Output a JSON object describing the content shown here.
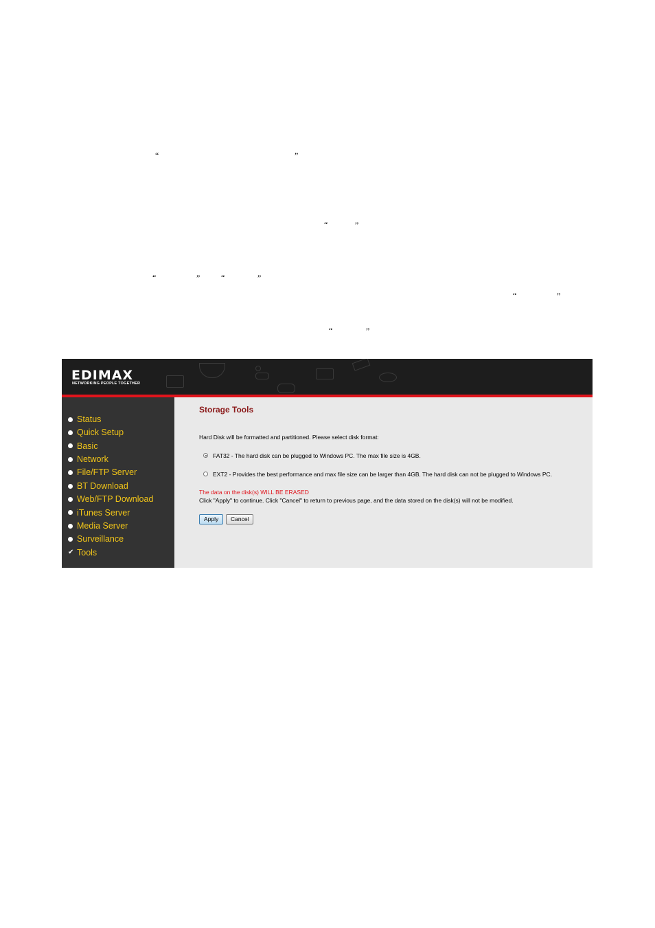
{
  "doc_quotes": {
    "q1": "“",
    "q2": "”",
    "q3": "“",
    "q4": "”",
    "q5": "“",
    "q6": "”",
    "q7": "“",
    "q8": "”",
    "q9": "“",
    "q10": "”",
    "q11": "“",
    "q12": "”"
  },
  "brand": {
    "logo": "EDIMAX",
    "tagline": "NETWORKING PEOPLE TOGETHER",
    "accent": "#e0141c"
  },
  "sidebar": {
    "items": [
      {
        "label": "Status",
        "icon": "bullet-icon"
      },
      {
        "label": "Quick Setup",
        "icon": "bullet-icon"
      },
      {
        "label": "Basic",
        "icon": "bullet-icon"
      },
      {
        "label": "Network",
        "icon": "bullet-icon"
      },
      {
        "label": "File/FTP Server",
        "icon": "bullet-icon"
      },
      {
        "label": "BT Download",
        "icon": "bullet-icon"
      },
      {
        "label": "Web/FTP Download",
        "icon": "bullet-icon"
      },
      {
        "label": "iTunes Server",
        "icon": "bullet-icon"
      },
      {
        "label": "Media Server",
        "icon": "bullet-icon"
      },
      {
        "label": "Surveillance",
        "icon": "bullet-icon"
      },
      {
        "label": "Tools",
        "icon": "check-icon"
      }
    ]
  },
  "main": {
    "title": "Storage Tools",
    "intro": "Hard Disk will be formatted and partitioned. Please select disk format:",
    "options": [
      {
        "label": "FAT32 - The hard disk can be plugged to Windows PC. The max file size is 4GB.",
        "selected": true
      },
      {
        "label": "EXT2 - Provides the best performance and max file size can be larger than 4GB. The hard disk can not be plugged to Windows PC.",
        "selected": false
      }
    ],
    "warning": "The data on the disk(s) WILL BE ERASED",
    "instruction": "Click \"Apply\" to continue. Click \"Cancel\" to return to previous page, and the data stored on the disk(s) will not be modified.",
    "apply_label": "Apply",
    "cancel_label": "Cancel"
  }
}
